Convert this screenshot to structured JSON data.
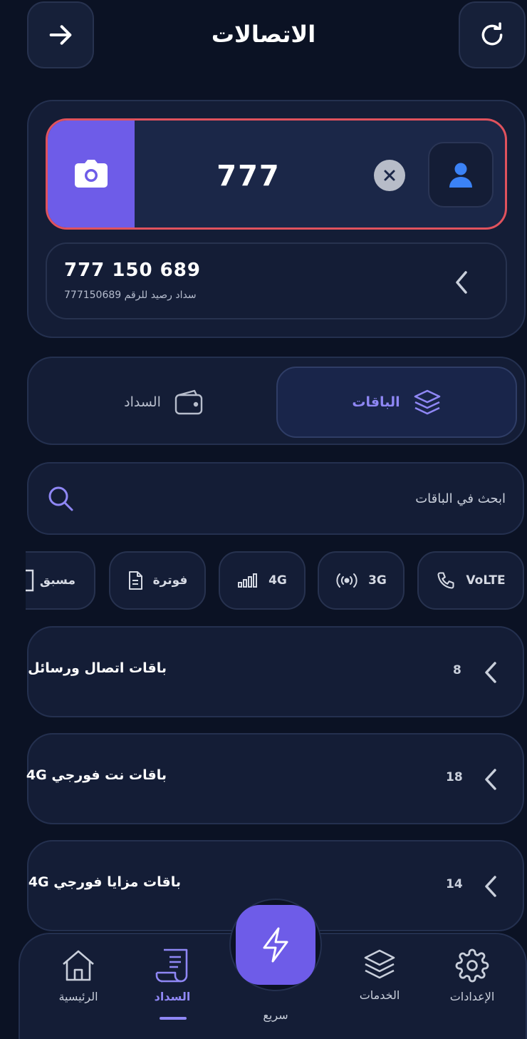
{
  "header": {
    "title": "الاتصالات"
  },
  "number_input": {
    "value": "777"
  },
  "suggestion": {
    "number": "777 150 689",
    "subtitle": "سداد رصيد للرقم 777150689"
  },
  "tabs": [
    {
      "label": "الباقات",
      "active": true
    },
    {
      "label": "السداد",
      "active": false
    }
  ],
  "search": {
    "placeholder": "ابحث في الباقات"
  },
  "chips": [
    {
      "label": "VoLTE",
      "icon": "phone-icon"
    },
    {
      "label": "3G",
      "icon": "signal-waves-icon"
    },
    {
      "label": "4G",
      "icon": "signal-bars-icon"
    },
    {
      "label": "فوترة",
      "icon": "document-icon"
    },
    {
      "label": "مسبق",
      "icon": "card-icon"
    }
  ],
  "categories": [
    {
      "title": "باقات اتصال ورسائل",
      "count": "8"
    },
    {
      "title": "باقات نت فورجي 4G",
      "count": "18"
    },
    {
      "title": "باقات مزايا فورجي 4G",
      "count": "14"
    }
  ],
  "bottom_nav": {
    "home": "الرئيسية",
    "payment": "السداد",
    "quick": "سريع",
    "services": "الخدمات",
    "settings": "الإعدادات"
  },
  "colors": {
    "background": "#0b1224",
    "card": "#141d36",
    "accent": "#6e5ce8",
    "accent_text": "#8f87f5",
    "error_border": "#e0525d",
    "contact_icon": "#3b82f6"
  }
}
